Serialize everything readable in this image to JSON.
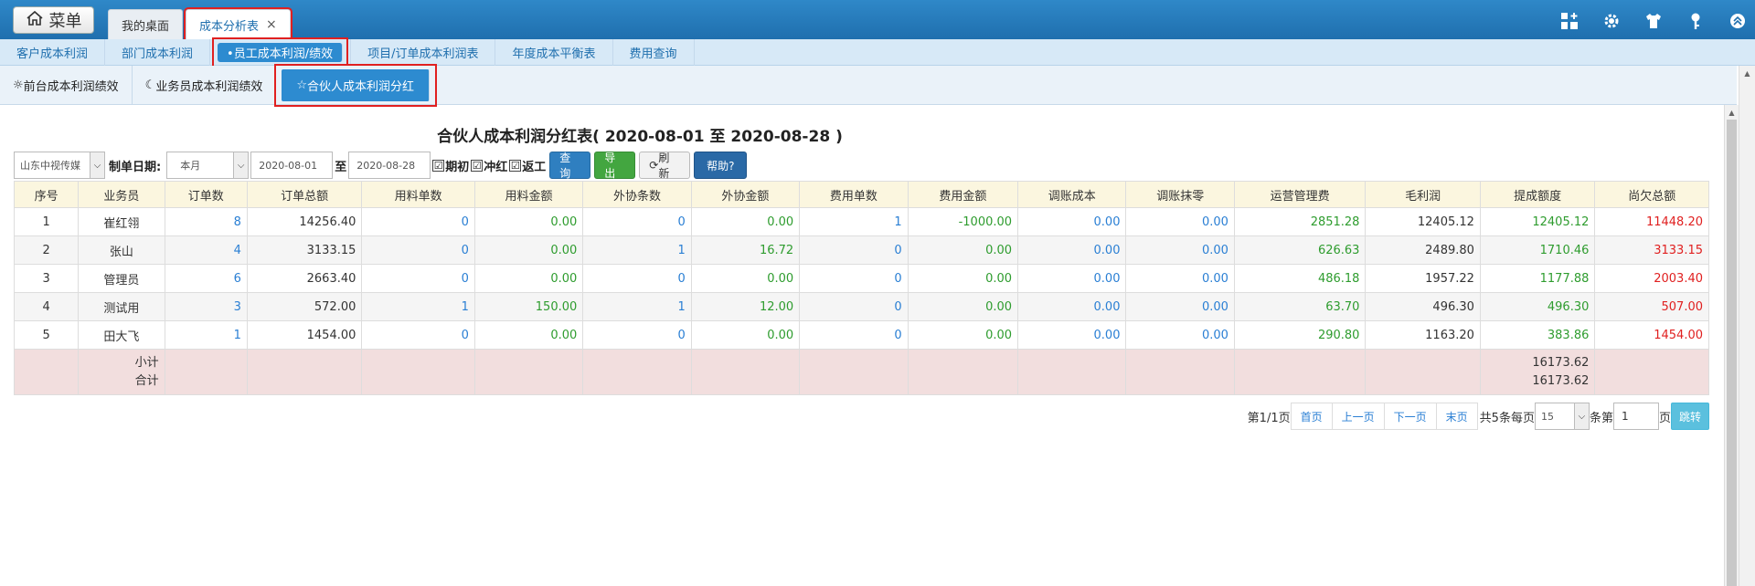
{
  "topbar": {
    "menu_label": "菜单",
    "tabs": [
      {
        "label": "我的桌面"
      },
      {
        "label": "成本分析表",
        "close": "×"
      }
    ],
    "icons": [
      "grid-add-icon",
      "gear-icon",
      "shirt-icon",
      "key-icon",
      "chevron-up-circle-icon"
    ]
  },
  "subnav": {
    "items": [
      {
        "label": "客户成本利润"
      },
      {
        "label": "部门成本利润"
      },
      {
        "label": "•员工成本利润/绩效"
      },
      {
        "label": "项目/订单成本利润表"
      },
      {
        "label": "年度成本平衡表"
      },
      {
        "label": "费用查询"
      }
    ]
  },
  "thirdnav": {
    "items": [
      {
        "label": "前台成本利润绩效",
        "icon": "☼"
      },
      {
        "label": "业务员成本利润绩效",
        "icon": "☾"
      },
      {
        "label": "合伙人成本利润分红",
        "icon": "☆"
      }
    ]
  },
  "report": {
    "title": "合伙人成本利润分红表( 2020-08-01 至 2020-08-28 )"
  },
  "filters": {
    "company": "山东中视传媒",
    "date_label": "制单日期:",
    "period": "本月",
    "date_from": "2020-08-01",
    "to_label": "至",
    "date_to": "2020-08-28",
    "checkboxes": [
      {
        "label": "期初",
        "checked": "☑"
      },
      {
        "label": "冲红",
        "checked": "☑"
      },
      {
        "label": "返工",
        "checked": "☑"
      }
    ],
    "buttons": {
      "query": "查询",
      "export": "导出",
      "refresh": "刷新",
      "help": "帮助?"
    }
  },
  "table": {
    "headers": [
      "序号",
      "业务员",
      "订单数",
      "订单总额",
      "用料单数",
      "用料金额",
      "外协条数",
      "外协金额",
      "费用单数",
      "费用金额",
      "调账成本",
      "调账抹零",
      "运营管理费",
      "毛利润",
      "提成额度",
      "尚欠总额"
    ],
    "rows": [
      [
        "1",
        "崔红翎",
        "8",
        "14256.40",
        "0",
        "0.00",
        "0",
        "0.00",
        "1",
        "-1000.00",
        "0.00",
        "0.00",
        "2851.28",
        "12405.12",
        "12405.12",
        "11448.20"
      ],
      [
        "2",
        "张山",
        "4",
        "3133.15",
        "0",
        "0.00",
        "1",
        "16.72",
        "0",
        "0.00",
        "0.00",
        "0.00",
        "626.63",
        "2489.80",
        "1710.46",
        "3133.15"
      ],
      [
        "3",
        "管理员",
        "6",
        "2663.40",
        "0",
        "0.00",
        "0",
        "0.00",
        "0",
        "0.00",
        "0.00",
        "0.00",
        "486.18",
        "1957.22",
        "1177.88",
        "2003.40"
      ],
      [
        "4",
        "测试用",
        "3",
        "572.00",
        "1",
        "150.00",
        "1",
        "12.00",
        "0",
        "0.00",
        "0.00",
        "0.00",
        "63.70",
        "496.30",
        "496.30",
        "507.00"
      ],
      [
        "5",
        "田大飞",
        "1",
        "1454.00",
        "0",
        "0.00",
        "0",
        "0.00",
        "0",
        "0.00",
        "0.00",
        "0.00",
        "290.80",
        "1163.20",
        "383.86",
        "1454.00"
      ]
    ],
    "subtotal_label": "小计",
    "total_label": "合计",
    "subtotal_value": "16173.62",
    "total_value": "16173.62"
  },
  "pager": {
    "page_info": "第1/1页",
    "first": "首页",
    "prev": "上一页",
    "next": "下一页",
    "last": "末页",
    "per_page_prefix": "共5条每页",
    "per_page": "15",
    "per_page_suffix": "条第",
    "page_input": "1",
    "page_suffix": "页",
    "go": "跳转"
  }
}
